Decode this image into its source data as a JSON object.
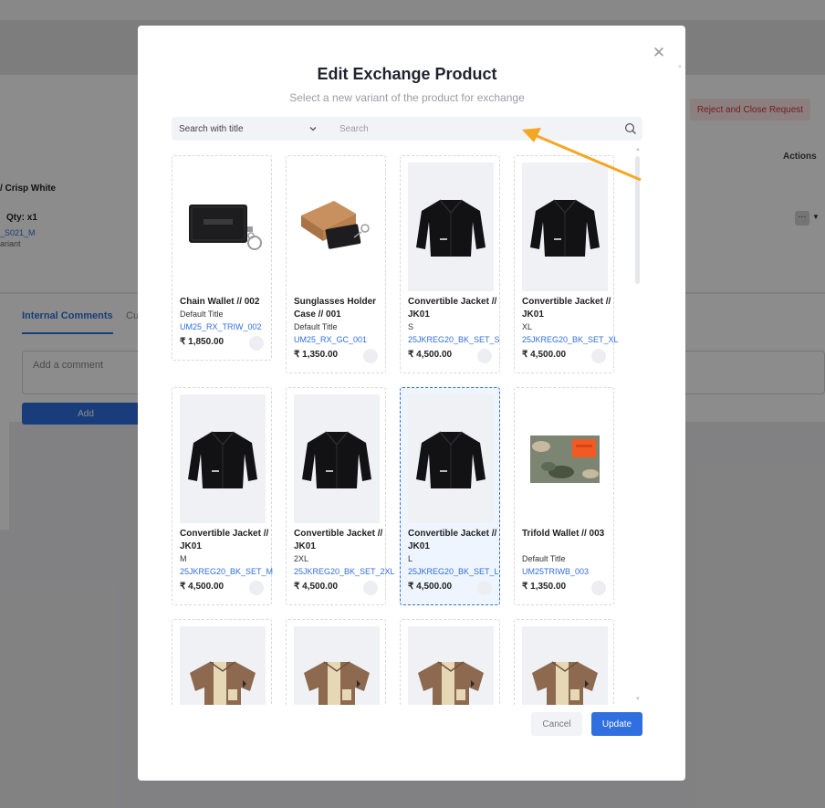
{
  "background": {
    "reject_button": "Reject and Close Request",
    "actions_header": "Actions",
    "item_variant_title": "/ Crisp White",
    "item_qty": "Qty: x1",
    "item_sku": "_S021_M",
    "item_variant_label": "ariant",
    "tabs": [
      {
        "label": "Internal Comments"
      },
      {
        "label": "Cu"
      }
    ],
    "comment_placeholder": "Add a comment",
    "add_button": "Add"
  },
  "modal": {
    "title": "Edit Exchange Product",
    "subtitle": "Select a new variant of the product for exchange",
    "close_icon": "close-icon",
    "search": {
      "select_value": "Search with title",
      "placeholder": "Search"
    },
    "products": [
      {
        "name": "Chain Wallet // 002",
        "variant": "Default Title",
        "sku": "UM25_RX_TRIW_002",
        "price": "₹ 1,850.00",
        "image": "wallet-chain",
        "selected": false
      },
      {
        "name": "Sunglasses Holder Case // 001",
        "variant": "Default Title",
        "sku": "UM25_RX_GC_001",
        "price": "₹ 1,350.00",
        "image": "glasses-case",
        "selected": false
      },
      {
        "name": "Convertible Jacket // JK01",
        "variant": "S",
        "sku": "25JKREG20_BK_SET_S",
        "price": "₹ 4,500.00",
        "image": "jacket",
        "selected": false
      },
      {
        "name": "Convertible Jacket // JK01",
        "variant": "XL",
        "sku": "25JKREG20_BK_SET_XL",
        "price": "₹ 4,500.00",
        "image": "jacket",
        "selected": false
      },
      {
        "name": "Convertible Jacket // JK01",
        "variant": "M",
        "sku": "25JKREG20_BK_SET_M",
        "price": "₹ 4,500.00",
        "image": "jacket",
        "selected": false
      },
      {
        "name": "Convertible Jacket // JK01",
        "variant": "2XL",
        "sku": "25JKREG20_BK_SET_2XL",
        "price": "₹ 4,500.00",
        "image": "jacket",
        "selected": false
      },
      {
        "name": "Convertible Jacket // JK01",
        "variant": "L",
        "sku": "25JKREG20_BK_SET_L",
        "price": "₹ 4,500.00",
        "image": "jacket",
        "selected": true
      },
      {
        "name": "Trifold Wallet // 003",
        "variant": "Default Title",
        "sku": "UM25TRIWB_003",
        "price": "₹ 1,350.00",
        "image": "camo-wallet",
        "selected": false
      },
      {
        "image": "shirt"
      },
      {
        "image": "shirt"
      },
      {
        "image": "shirt"
      },
      {
        "image": "shirt"
      }
    ],
    "cancel_label": "Cancel",
    "update_label": "Update"
  },
  "colors": {
    "primary": "#2f6fe0",
    "annotation_arrow": "#f5a623",
    "danger_text": "#d13a3a"
  }
}
